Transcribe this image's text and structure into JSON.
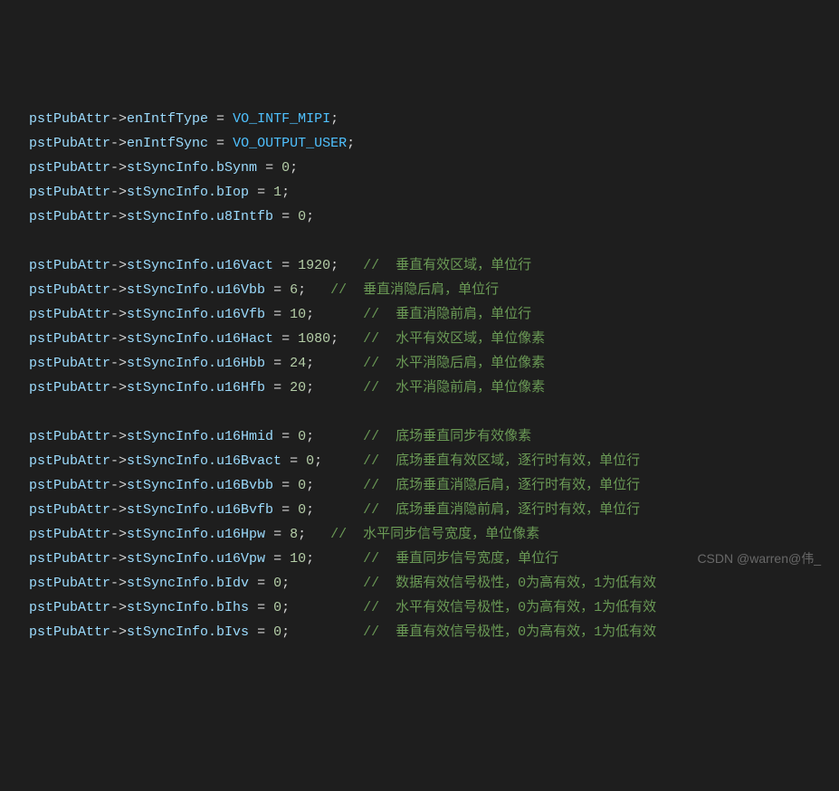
{
  "code": {
    "var": "pstPubAttr",
    "arrow": "->",
    "lines": [
      {
        "prop": "enIntfType",
        "op": " = ",
        "const": "VO_INTF_MIPI",
        "end": ";"
      },
      {
        "prop": "enIntfSync",
        "op": " = ",
        "const": "VO_OUTPUT_USER",
        "end": ";"
      },
      {
        "prop": "stSyncInfo.bSynm",
        "op": " = ",
        "num": "0",
        "end": ";"
      },
      {
        "prop": "stSyncInfo.bIop",
        "op": " = ",
        "num": "1",
        "end": ";"
      },
      {
        "prop": "stSyncInfo.u8Intfb",
        "op": " = ",
        "num": "0",
        "end": ";"
      },
      {
        "blank": true
      },
      {
        "prop": "stSyncInfo.u16Vact",
        "op": " = ",
        "num": "1920",
        "end": ";   ",
        "comment": "//  垂直有效区域，单位行"
      },
      {
        "prop": "stSyncInfo.u16Vbb",
        "op": " = ",
        "num": "6",
        "end": ";   ",
        "comment": "//  垂直消隐后肩，单位行"
      },
      {
        "prop": "stSyncInfo.u16Vfb",
        "op": " = ",
        "num": "10",
        "end": ";      ",
        "comment": "//  垂直消隐前肩，单位行"
      },
      {
        "prop": "stSyncInfo.u16Hact",
        "op": " = ",
        "num": "1080",
        "end": ";   ",
        "comment": "//  水平有效区域，单位像素"
      },
      {
        "prop": "stSyncInfo.u16Hbb",
        "op": " = ",
        "num": "24",
        "end": ";      ",
        "comment": "//  水平消隐后肩，单位像素"
      },
      {
        "prop": "stSyncInfo.u16Hfb",
        "op": " = ",
        "num": "20",
        "end": ";      ",
        "comment": "//  水平消隐前肩，单位像素"
      },
      {
        "blank": true
      },
      {
        "prop": "stSyncInfo.u16Hmid",
        "op": " = ",
        "num": "0",
        "end": ";      ",
        "comment": "//  底场垂直同步有效像素"
      },
      {
        "prop": "stSyncInfo.u16Bvact",
        "op": " = ",
        "num": "0",
        "end": ";     ",
        "comment": "//  底场垂直有效区域，逐行时有效，单位行"
      },
      {
        "prop": "stSyncInfo.u16Bvbb",
        "op": " = ",
        "num": "0",
        "end": ";      ",
        "comment": "//  底场垂直消隐后肩，逐行时有效，单位行"
      },
      {
        "prop": "stSyncInfo.u16Bvfb",
        "op": " = ",
        "num": "0",
        "end": ";      ",
        "comment": "//  底场垂直消隐前肩，逐行时有效，单位行"
      },
      {
        "prop": "stSyncInfo.u16Hpw",
        "op": " = ",
        "num": "8",
        "end": ";   ",
        "comment": "//  水平同步信号宽度，单位像素"
      },
      {
        "prop": "stSyncInfo.u16Vpw",
        "op": " = ",
        "num": "10",
        "end": ";      ",
        "comment": "//  垂直同步信号宽度，单位行"
      },
      {
        "prop": "stSyncInfo.bIdv",
        "op": " = ",
        "num": "0",
        "end": ";         ",
        "comment": "//  数据有效信号极性，0为高有效，1为低有效"
      },
      {
        "prop": "stSyncInfo.bIhs",
        "op": " = ",
        "num": "0",
        "end": ";         ",
        "comment": "//  水平有效信号极性，0为高有效，1为低有效"
      },
      {
        "prop": "stSyncInfo.bIvs",
        "op": " = ",
        "num": "0",
        "end": ";         ",
        "comment": "//  垂直有效信号极性，0为高有效，1为低有效"
      }
    ]
  },
  "watermark": "CSDN @warren@伟_"
}
